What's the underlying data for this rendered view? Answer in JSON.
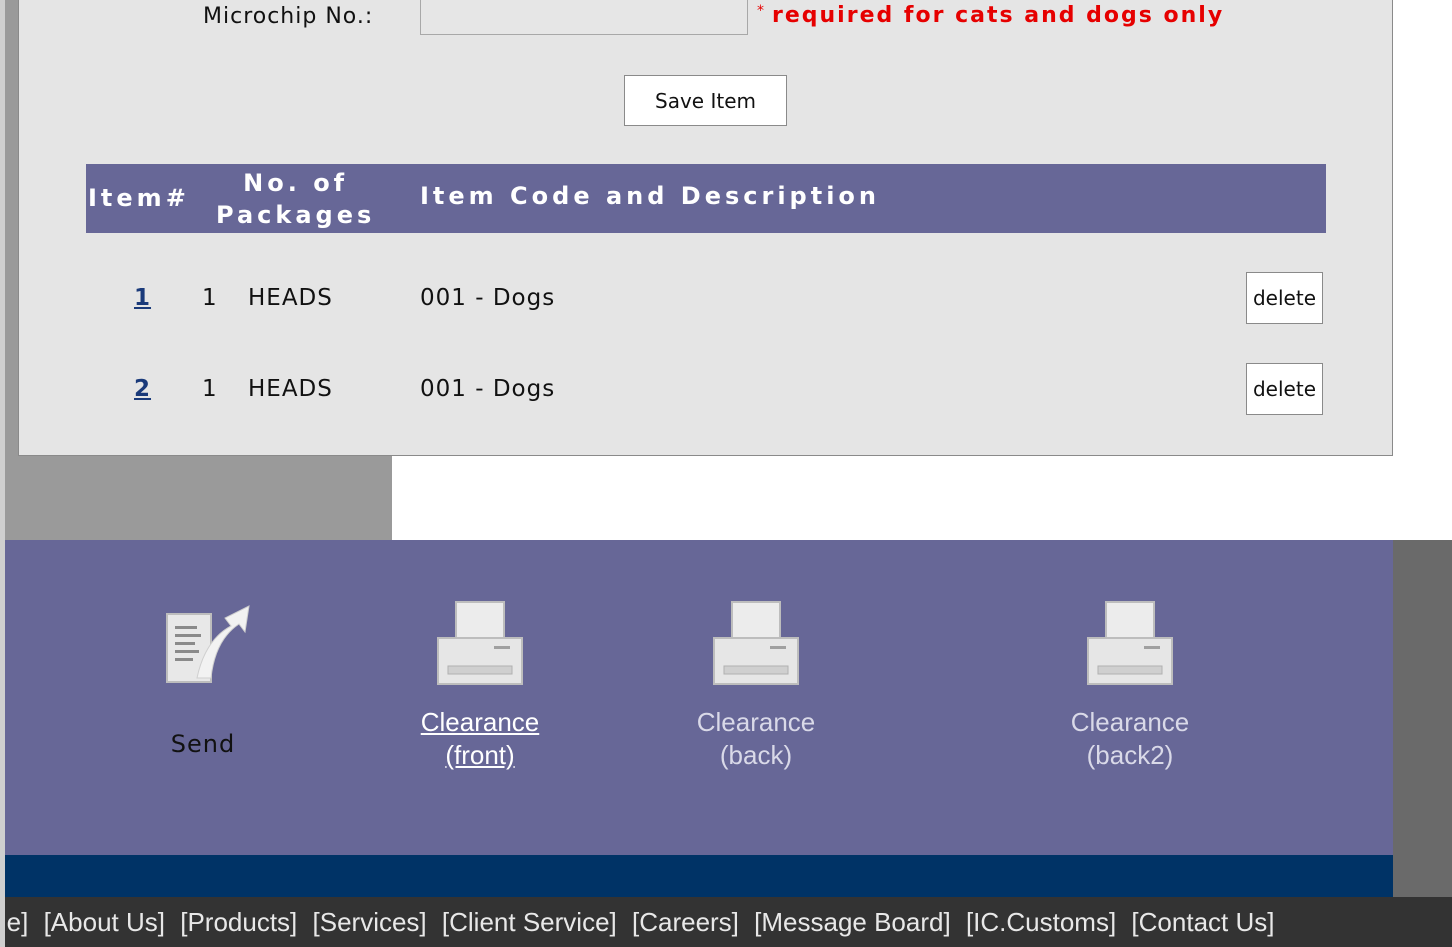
{
  "form": {
    "microchip_label": "Microchip No.:",
    "microchip_value": "",
    "required_star": "*",
    "required_note": "required for cats and dogs only",
    "save_label": "Save Item"
  },
  "table": {
    "headers": {
      "item": "Item#",
      "packages_line1": "No. of",
      "packages_line2": "Packages",
      "description": "Item Code and Description"
    },
    "rows": [
      {
        "num": "1",
        "packages": "1",
        "unit": "HEADS",
        "description": "001 - Dogs",
        "delete_label": "delete"
      },
      {
        "num": "2",
        "packages": "1",
        "unit": "HEADS",
        "description": "001 - Dogs",
        "delete_label": "delete"
      }
    ]
  },
  "actions": {
    "send": {
      "label": "Send",
      "icon": "send-document-icon"
    },
    "clearance_front": {
      "line1": "Clearance",
      "line2": "(front)",
      "icon": "printer-icon"
    },
    "clearance_back": {
      "line1": "Clearance",
      "line2": "(back)",
      "icon": "printer-icon"
    },
    "clearance_back2": {
      "line1": "Clearance",
      "line2": "(back2)",
      "icon": "printer-icon"
    }
  },
  "footer": {
    "links": [
      "me]",
      "[About Us]",
      "[Products]",
      "[Services]",
      "[Client Service]",
      "[Careers]",
      "[Message Board]",
      "[IC.Customs]",
      "[Contact Us]"
    ]
  },
  "colors": {
    "header_bar": "#676797",
    "required_red": "#e60000",
    "navy": "#003366",
    "footer_bg": "#333333",
    "panel_bg": "#e5e5e5"
  }
}
